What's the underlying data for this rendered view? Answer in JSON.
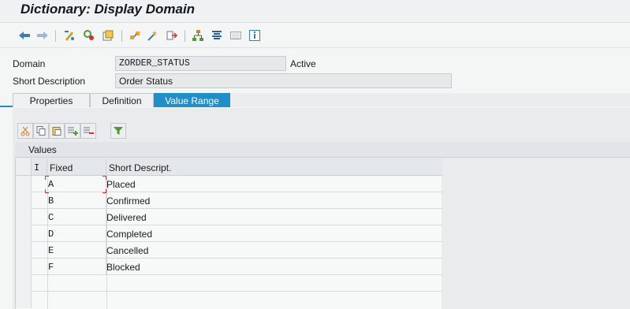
{
  "window": {
    "title": "Dictionary: Display Domain"
  },
  "toolbar": {
    "icons": [
      "back-arrow-icon",
      "forward-arrow-icon",
      "display-change-icon",
      "other-object-icon",
      "activate-icon",
      "check-icon",
      "where-used-icon",
      "transport-icon",
      "hierarchy-icon",
      "documentation-icon",
      "list-icon",
      "info-icon"
    ]
  },
  "header": {
    "domain_label": "Domain",
    "domain_value": "ZORDER_STATUS",
    "domain_status": "Active",
    "short_desc_label": "Short Description",
    "short_desc_value": "Order Status"
  },
  "tabs": [
    {
      "label": "Properties",
      "active": false
    },
    {
      "label": "Definition",
      "active": false
    },
    {
      "label": "Value Range",
      "active": true
    }
  ],
  "values": {
    "title": "Values",
    "columns": [
      "I",
      "Fixed",
      "Short Descript."
    ],
    "rows": [
      {
        "fixed": "A",
        "desc": "Placed"
      },
      {
        "fixed": "B",
        "desc": "Confirmed"
      },
      {
        "fixed": "C",
        "desc": "Delivered"
      },
      {
        "fixed": "D",
        "desc": "Completed"
      },
      {
        "fixed": "E",
        "desc": "Cancelled"
      },
      {
        "fixed": "F",
        "desc": "Blocked"
      }
    ]
  },
  "colors": {
    "accent": "#1e8fc8",
    "focus_marker": "#d8332a"
  }
}
